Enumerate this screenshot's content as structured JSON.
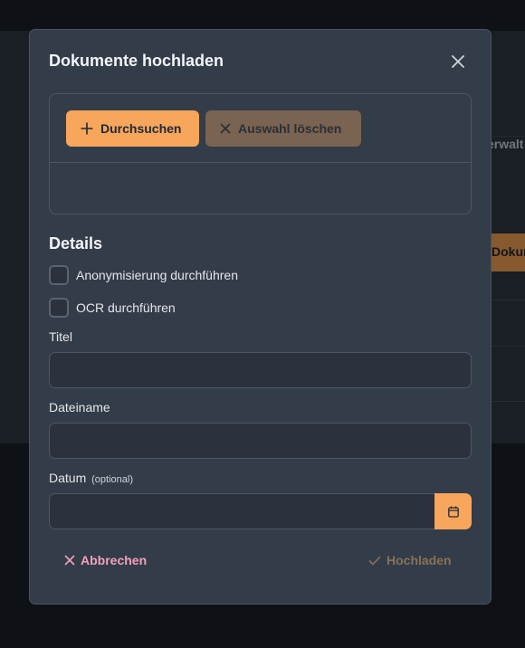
{
  "background": {
    "header_fragment": "erwalt",
    "button_fragment": "Dokum"
  },
  "dialog": {
    "title": "Dokumente hochladen",
    "close_icon": "close-icon",
    "upload": {
      "browse_label": "Durchsuchen",
      "browse_icon": "plus-icon",
      "clear_label": "Auswahl löschen",
      "clear_icon": "x-icon"
    },
    "details": {
      "title": "Details",
      "checkboxes": [
        {
          "label": "Anonymisierung durchführen",
          "checked": false
        },
        {
          "label": "OCR durchführen",
          "checked": false
        }
      ],
      "fields": {
        "title_label": "Titel",
        "title_value": "",
        "filename_label": "Dateiname",
        "filename_value": "",
        "date_label": "Datum",
        "date_optional": "(optional)",
        "date_value": "",
        "date_icon": "calendar-icon"
      }
    },
    "footer": {
      "cancel_label": "Abbrechen",
      "cancel_icon": "x-icon",
      "upload_label": "Hochladen",
      "upload_icon": "check-icon"
    }
  },
  "colors": {
    "accent": "#f7a65b",
    "cancel": "#f3a0bd",
    "dialog_bg": "#333c49"
  }
}
